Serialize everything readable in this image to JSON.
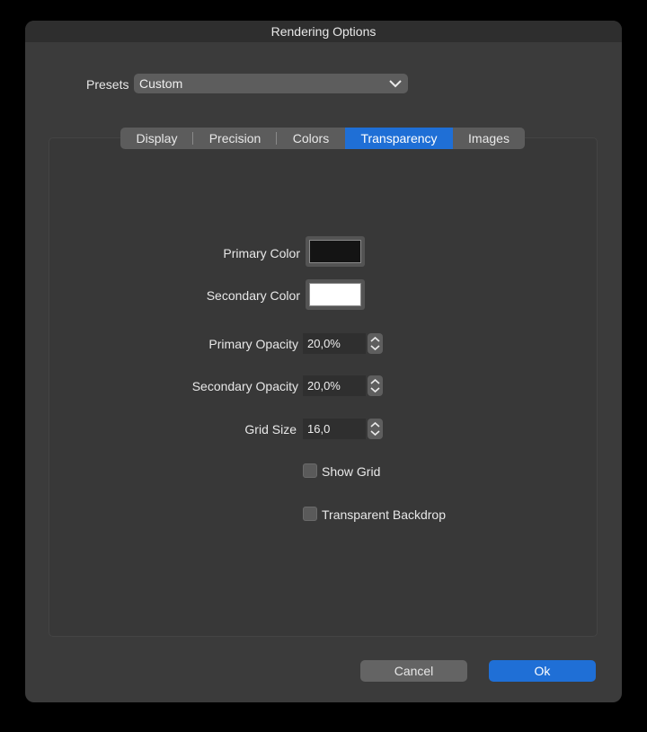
{
  "window": {
    "title": "Rendering Options"
  },
  "presets": {
    "label": "Presets",
    "value": "Custom",
    "icon": "chevron-down-icon"
  },
  "tabs": [
    {
      "label": "Display",
      "active": false
    },
    {
      "label": "Precision",
      "active": false
    },
    {
      "label": "Colors",
      "active": false
    },
    {
      "label": "Transparency",
      "active": true
    },
    {
      "label": "Images",
      "active": false
    }
  ],
  "transparency": {
    "primary_color": {
      "label": "Primary Color",
      "color": "#141414"
    },
    "secondary_color": {
      "label": "Secondary Color",
      "color": "#ffffff"
    },
    "primary_opacity": {
      "label": "Primary Opacity",
      "value": "20,0%"
    },
    "secondary_opacity": {
      "label": "Secondary Opacity",
      "value": "20,0%"
    },
    "grid_size": {
      "label": "Grid Size",
      "value": "16,0"
    },
    "show_grid": {
      "label": "Show Grid",
      "checked": false
    },
    "transparent_backdrop": {
      "label": "Transparent Backdrop",
      "checked": false
    }
  },
  "buttons": {
    "cancel": "Cancel",
    "ok": "Ok"
  },
  "colors": {
    "accent": "#1f6fd6",
    "window_bg": "#3b3b3b"
  }
}
